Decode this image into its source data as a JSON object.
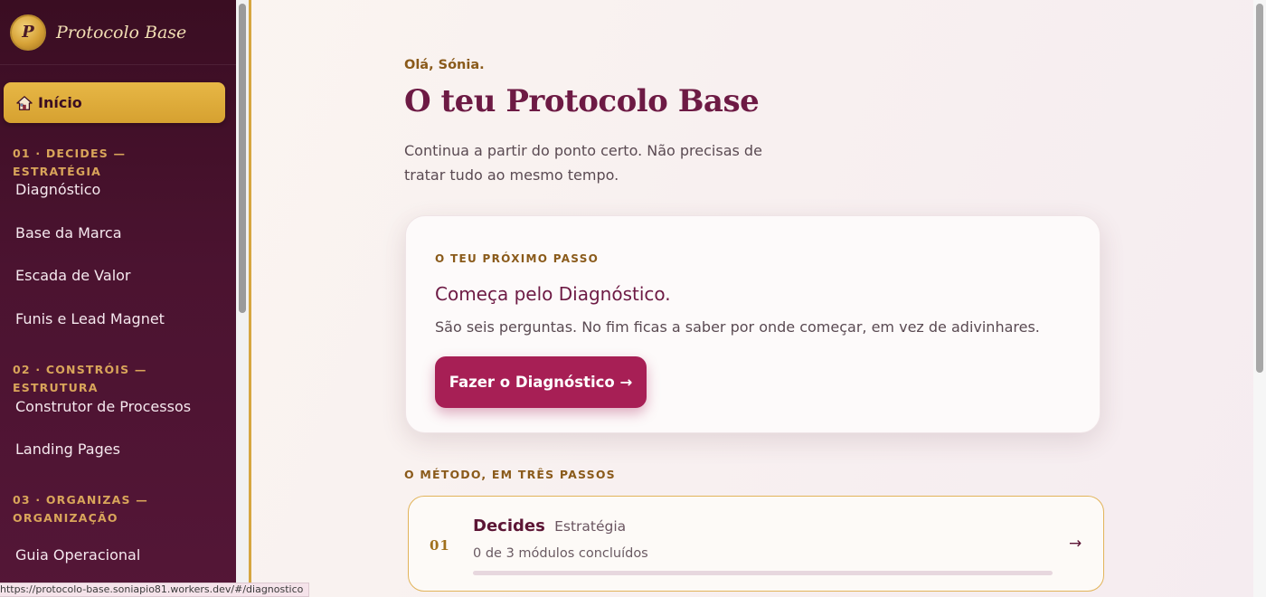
{
  "brand": {
    "logo_letter": "P",
    "name": "Protocolo Base"
  },
  "nav": {
    "home_label": "Início",
    "sections": [
      {
        "title": "01 · DECIDES — ESTRATÉGIA",
        "items": [
          "Diagnóstico",
          "Base da Marca",
          "Escada de Valor",
          "Funis e Lead Magnet"
        ]
      },
      {
        "title": "02 · CONSTRÓIS — ESTRUTURA",
        "items": [
          "Construtor de Processos",
          "Landing Pages"
        ]
      },
      {
        "title": "03 · ORGANIZAS — ORGANIZAÇÃO",
        "items": [
          "Guia Operacional"
        ]
      }
    ]
  },
  "main": {
    "greeting": "Olá, Sónia.",
    "title": "O teu Protocolo Base",
    "intro": "Continua a partir do ponto certo. Não precisas de tratar tudo ao mesmo tempo.",
    "next_step": {
      "eyebrow": "O TEU PRÓXIMO PASSO",
      "title": "Começa pelo Diagnóstico.",
      "text": "São seis perguntas. No fim ficas a saber por onde começar, em vez de adivinhares.",
      "button_label": "Fazer o Diagnóstico →"
    },
    "method": {
      "label": "O MÉTODO, EM TRÊS PASSOS",
      "steps": [
        {
          "number": "01",
          "title": "Decides",
          "subtitle": "Estratégia",
          "progress_text": "0 de 3 módulos concluídos",
          "progress": 0,
          "arrow": "→"
        }
      ]
    }
  },
  "status_url": "https://protocolo-base.soniapio81.workers.dev/#/diagnostico",
  "colors": {
    "sidebar": "#4b1330",
    "accent_gold": "#d6a130",
    "primary": "#a71f55",
    "title": "#6d1a44"
  }
}
